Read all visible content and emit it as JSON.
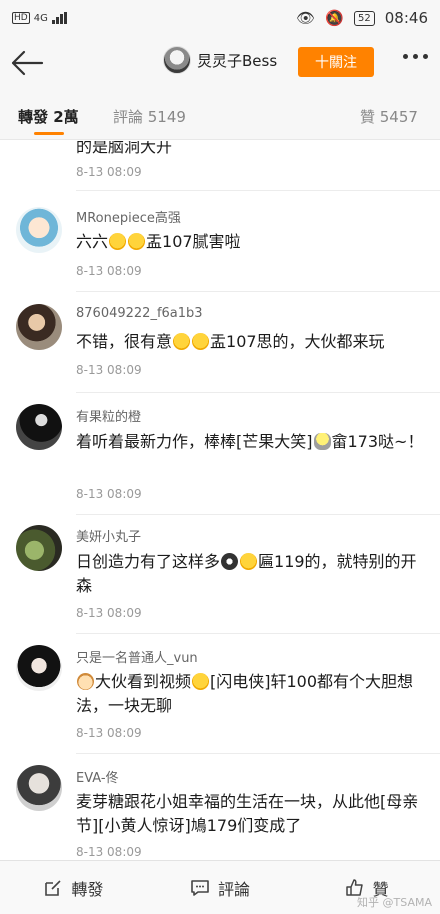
{
  "status": {
    "network": "4G",
    "battery": "52",
    "time": "08:46"
  },
  "header": {
    "username": "炅灵子Bess",
    "follow_label": "十關注"
  },
  "tabs": [
    {
      "label": "轉發 2萬",
      "active": true
    },
    {
      "label": "評論 5149",
      "active": false
    },
    {
      "label": "贊 5457",
      "active": false
    }
  ],
  "comments": [
    {
      "username": "",
      "text": "的是脑洞大开",
      "time": "8-13 08:09",
      "avatar": ""
    },
    {
      "username": "MRonepiece高强",
      "text_a": "六六",
      "text_b": "盂107腻害啦",
      "time": "8-13 08:09",
      "avatar": "cartoon-girl"
    },
    {
      "username": "876049222_f6a1b3",
      "text_a": "不错，很有意",
      "text_b": "盂107思的，大伙都来玩",
      "time": "8-13 08:09",
      "avatar": "photo-person"
    },
    {
      "username": "有果粒的橙",
      "text_a": "着听着最新力作，棒棒[芒果大笑]",
      "text_b": "畲173哒~！",
      "time": "8-13 08:09",
      "avatar": "dark-photo"
    },
    {
      "username": "美妍小丸子",
      "text_a": "日创造力有了这样多",
      "text_b": "匾119的，就特别的开森",
      "time": "8-13 08:09",
      "avatar": "plant-photo"
    },
    {
      "username": "只是一名普通人_vun",
      "text_a": "大伙看到视频",
      "text_b": "[闪电侠]轩100都有个大胆想法，一块无聊",
      "time": "8-13 08:09",
      "avatar": "black-hair"
    },
    {
      "username": "EVA-佟",
      "text": "麦芽糖跟花小姐幸福的生活在一块，从此他[母亲节][小黄人惊讶]鳩179们变成了",
      "time": "8-13 08:09",
      "avatar": "portrait"
    }
  ],
  "bottom": {
    "repost": "轉發",
    "comment": "評論",
    "like": "贊"
  },
  "watermark": "知乎 @TSAMA"
}
